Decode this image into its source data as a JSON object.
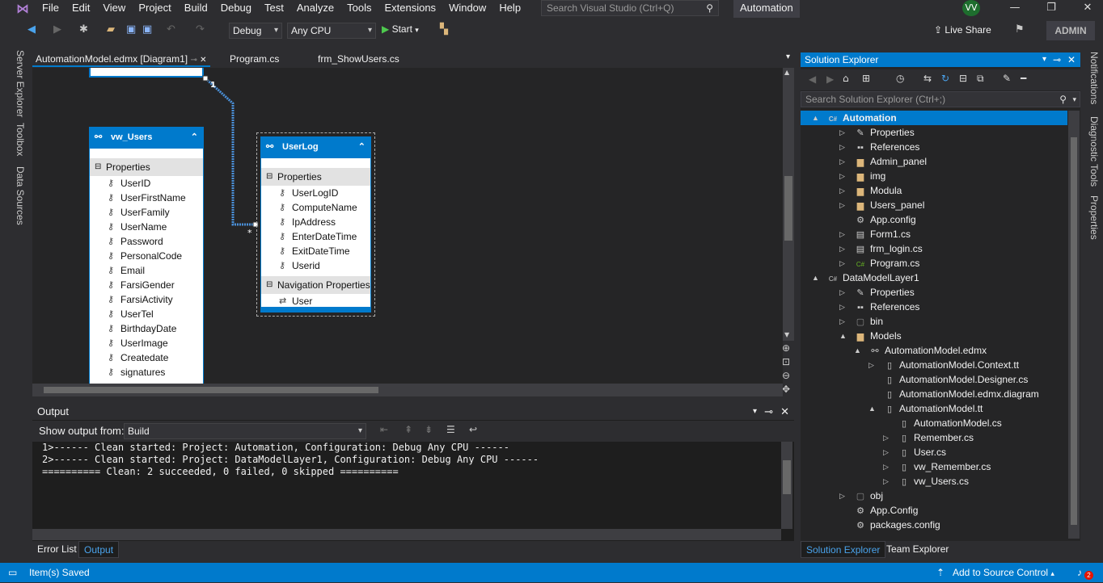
{
  "menu": [
    "File",
    "Edit",
    "View",
    "Project",
    "Build",
    "Debug",
    "Test",
    "Analyze",
    "Tools",
    "Extensions",
    "Window",
    "Help"
  ],
  "search_placeholder": "Search Visual Studio (Ctrl+Q)",
  "solution_name": "Automation",
  "user_initials": "VV",
  "toolbar": {
    "config": "Debug",
    "platform": "Any CPU",
    "start": "Start",
    "live_share": "Live Share",
    "admin": "ADMIN"
  },
  "side_tabs_left": [
    "Server Explorer",
    "Toolbox",
    "Data Sources"
  ],
  "side_tabs_right": [
    "Notifications",
    "Diagnostic Tools",
    "Properties"
  ],
  "doc_tabs": [
    "AutomationModel.edmx [Diagram1]",
    "Program.cs",
    "frm_ShowUsers.cs"
  ],
  "entities": {
    "vw_users": {
      "name": "vw_Users",
      "section": "Properties",
      "props": [
        "UserID",
        "UserFirstName",
        "UserFamily",
        "UserName",
        "Password",
        "PersonalCode",
        "Email",
        "FarsiGender",
        "FarsiActivity",
        "UserTel",
        "BirthdayDate",
        "UserImage",
        "Createdate",
        "signatures"
      ]
    },
    "userlog": {
      "name": "UserLog",
      "section": "Properties",
      "props": [
        "UserLogID",
        "ComputeName",
        "IpAddress",
        "EnterDateTime",
        "ExitDateTime",
        "Userid"
      ],
      "nav_section": "Navigation Properties",
      "nav_props": [
        "User"
      ]
    },
    "multiplicity_one": "1",
    "multiplicity_many": "*"
  },
  "output": {
    "title": "Output",
    "show_from_label": "Show output from:",
    "source": "Build",
    "lines": [
      "1>------ Clean started: Project: Automation, Configuration: Debug Any CPU ------",
      "2>------ Clean started: Project: DataModelLayer1, Configuration: Debug Any CPU ------",
      "========== Clean: 2 succeeded, 0 failed, 0 skipped =========="
    ]
  },
  "bottom_tabs": [
    "Error List",
    "Output"
  ],
  "solution_explorer": {
    "title": "Solution Explorer",
    "search_placeholder": "Search Solution Explorer (Ctrl+;)",
    "tree": [
      {
        "label": "Automation",
        "icon": "csharp-project-icon"
      },
      {
        "label": "Properties",
        "icon": "wrench-icon"
      },
      {
        "label": "References",
        "icon": "references-icon"
      },
      {
        "label": "Admin_panel",
        "icon": "folder-icon"
      },
      {
        "label": "img",
        "icon": "folder-icon"
      },
      {
        "label": "Modula",
        "icon": "folder-icon"
      },
      {
        "label": "Users_panel",
        "icon": "folder-icon"
      },
      {
        "label": "App.config",
        "icon": "config-file-icon"
      },
      {
        "label": "Form1.cs",
        "icon": "form-icon"
      },
      {
        "label": "frm_login.cs",
        "icon": "form-icon"
      },
      {
        "label": "Program.cs",
        "icon": "csharp-file-icon"
      },
      {
        "label": "DataModelLayer1",
        "icon": "csharp-project-icon"
      },
      {
        "label": "Properties",
        "icon": "wrench-icon"
      },
      {
        "label": "References",
        "icon": "references-icon"
      },
      {
        "label": "bin",
        "icon": "folder-hidden-icon"
      },
      {
        "label": "Models",
        "icon": "folder-open-icon"
      },
      {
        "label": "AutomationModel.edmx",
        "icon": "edmx-icon"
      },
      {
        "label": "AutomationModel.Context.tt",
        "icon": "file-icon"
      },
      {
        "label": "AutomationModel.Designer.cs",
        "icon": "file-icon"
      },
      {
        "label": "AutomationModel.edmx.diagram",
        "icon": "file-icon"
      },
      {
        "label": "AutomationModel.tt",
        "icon": "file-icon"
      },
      {
        "label": "AutomationModel.cs",
        "icon": "file-icon"
      },
      {
        "label": "Remember.cs",
        "icon": "file-icon"
      },
      {
        "label": "User.cs",
        "icon": "file-icon"
      },
      {
        "label": "vw_Remember.cs",
        "icon": "file-icon"
      },
      {
        "label": "vw_Users.cs",
        "icon": "file-icon"
      },
      {
        "label": "obj",
        "icon": "folder-hidden-icon"
      },
      {
        "label": "App.Config",
        "icon": "config-file-icon"
      },
      {
        "label": "packages.config",
        "icon": "config-file-icon"
      }
    ],
    "bottom_tabs": [
      "Solution Explorer",
      "Team Explorer"
    ]
  },
  "status": {
    "message": "Item(s) Saved",
    "source_control": "Add to Source Control",
    "notifications_count": "2"
  }
}
